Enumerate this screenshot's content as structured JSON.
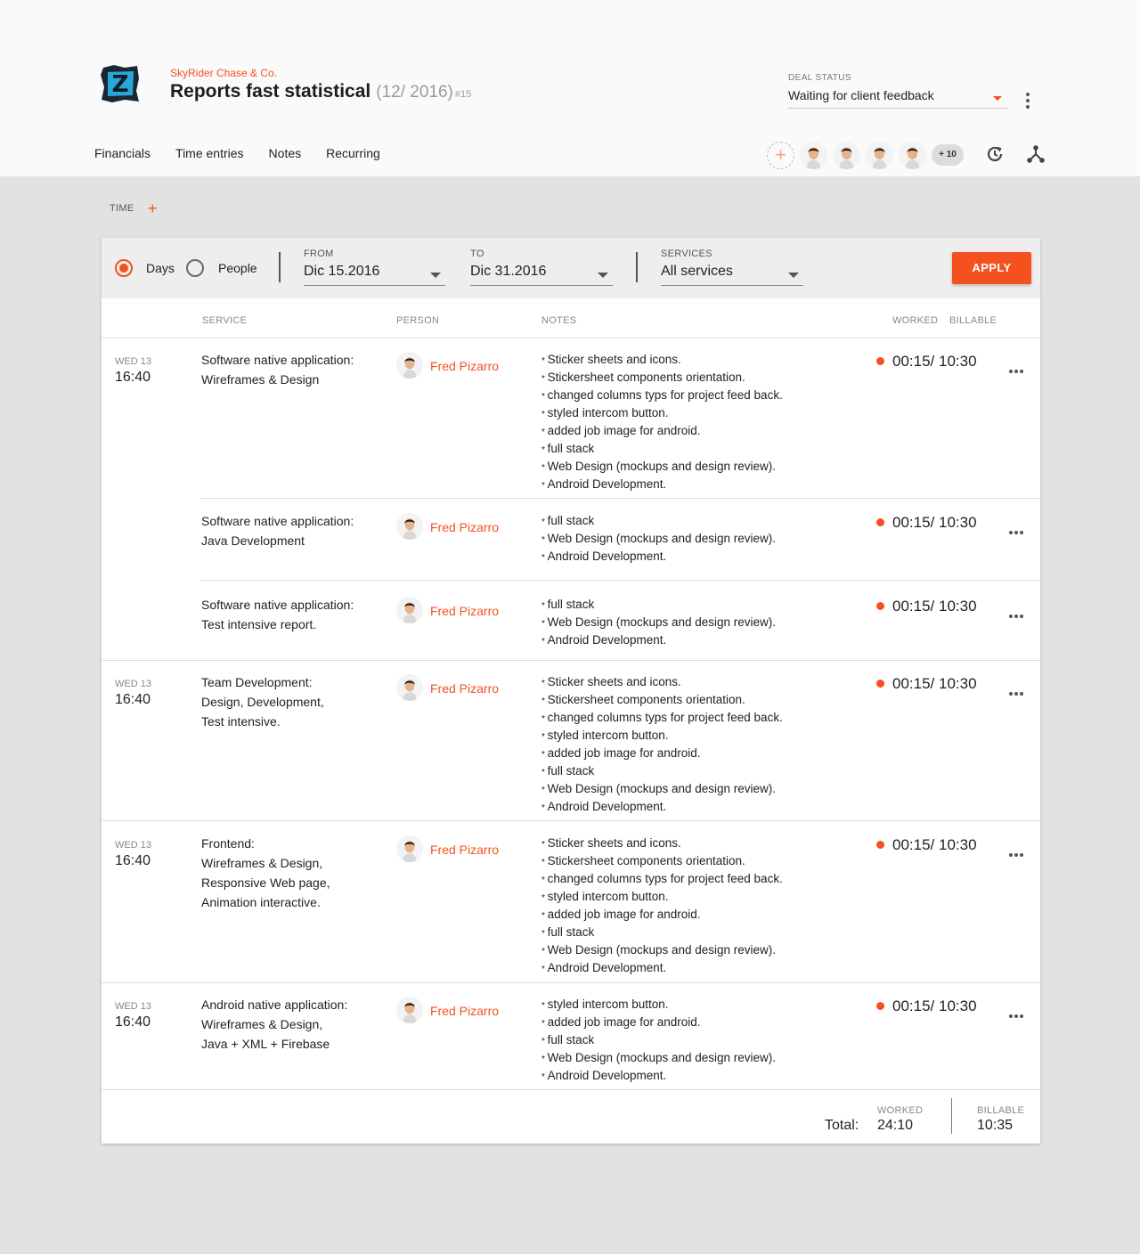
{
  "header": {
    "company": "SkyRider Chase & Co.",
    "title": "Reports fast statistical",
    "period": "(12/ 2016)",
    "number": "#15",
    "deal_status_label": "DEAL STATUS",
    "deal_status_value": "Waiting for client feedback",
    "tabs": [
      "Financials",
      "Time entries",
      "Notes",
      "Recurring"
    ],
    "members_more": "+ 10",
    "accent_color": "#f4511e"
  },
  "section": {
    "label": "TIME",
    "add": "+"
  },
  "filters": {
    "mode_days": "Days",
    "mode_people": "People",
    "selected_mode": "Days",
    "from_label": "FROM",
    "from_value": "Dic 15.2016",
    "to_label": "TO",
    "to_value": "Dic 31.2016",
    "services_label": "SERVICES",
    "services_value": "All services",
    "apply": "APPLY"
  },
  "columns": {
    "service": "SERVICE",
    "person": "PERSON",
    "notes": "NOTES",
    "worked": "WORKED",
    "billable": "BILLABLE"
  },
  "groups": [
    {
      "day": "WED 13",
      "time": "16:40",
      "entries": [
        {
          "service": [
            "Software native application:",
            "Wireframes & Design"
          ],
          "person": "Fred Pizarro",
          "notes": [
            "Sticker sheets and icons.",
            "Stickersheet components orientation.",
            "changed columns typs for project feed back.",
            "styled intercom button.",
            "added job image for android.",
            "full stack",
            "Web Design (mockups and design review).",
            "Android Development."
          ],
          "worked": "00:15/ 10:30"
        },
        {
          "service": [
            "Software native application:",
            "Java Development"
          ],
          "person": "Fred Pizarro",
          "notes": [
            "full stack",
            "Web Design (mockups and design review).",
            "Android Development."
          ],
          "worked": "00:15/ 10:30"
        },
        {
          "service": [
            "Software native application:",
            "Test intensive report."
          ],
          "person": "Fred Pizarro",
          "notes": [
            "full stack",
            "Web Design (mockups and design review).",
            "Android Development."
          ],
          "worked": "00:15/ 10:30"
        }
      ]
    },
    {
      "day": "WED 13",
      "time": "16:40",
      "entries": [
        {
          "service": [
            "Team Development:",
            "Design, Development,",
            "Test intensive."
          ],
          "person": "Fred Pizarro",
          "notes": [
            "Sticker sheets and icons.",
            "Stickersheet components orientation.",
            "changed columns typs for project feed back.",
            "styled intercom button.",
            "added job image for android.",
            "full stack",
            "Web Design (mockups and design review).",
            "Android Development."
          ],
          "worked": "00:15/ 10:30"
        }
      ]
    },
    {
      "day": "WED 13",
      "time": "16:40",
      "entries": [
        {
          "service": [
            "Frontend:",
            "Wireframes & Design,",
            "Responsive Web page,",
            "Animation interactive."
          ],
          "person": "Fred Pizarro",
          "notes": [
            "Sticker sheets and icons.",
            "Stickersheet components orientation.",
            "changed columns typs for project feed back.",
            "styled intercom button.",
            "added job image for android.",
            "full stack",
            "Web Design (mockups and design review).",
            "Android Development."
          ],
          "worked": "00:15/ 10:30"
        }
      ]
    },
    {
      "day": "WED 13",
      "time": "16:40",
      "entries": [
        {
          "service": [
            "Android native application:",
            "Wireframes & Design,",
            "Java + XML + Firebase"
          ],
          "person": "Fred Pizarro",
          "notes": [
            "styled intercom button.",
            "added job image for android.",
            "full stack",
            "Web Design (mockups and design review).",
            "Android Development."
          ],
          "worked": "00:15/ 10:30"
        }
      ]
    }
  ],
  "totals": {
    "label": "Total:",
    "worked_label": "WORKED",
    "worked_value": "24:10",
    "billable_label": "BILLABLE",
    "billable_value": "10:35"
  }
}
